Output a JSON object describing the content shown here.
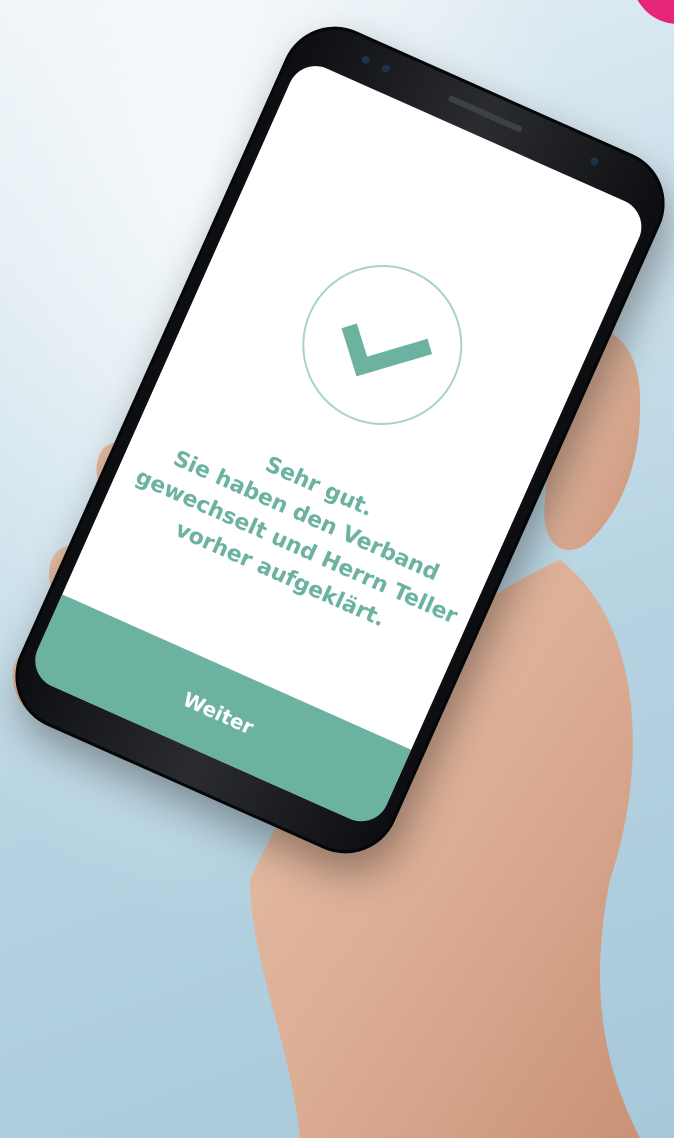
{
  "screen": {
    "message_lines": [
      "Sehr gut.",
      "Sie haben den Verband",
      "gewechselt und Herrn Teller",
      "vorher aufgeklärt."
    ],
    "continue_label": "Weiter",
    "success_icon": "checkmark-icon"
  },
  "colors": {
    "accent": "#6bb2a1",
    "ring": "#a8d3c6",
    "pink": "#e6247a"
  }
}
